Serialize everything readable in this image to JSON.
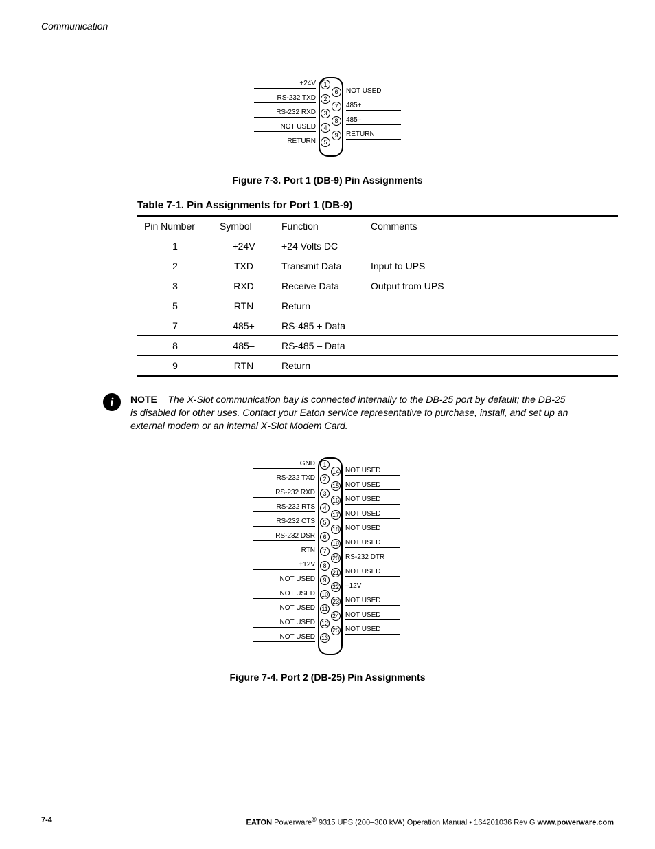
{
  "header": {
    "section": "Communication"
  },
  "figure73": {
    "caption": "Figure 7-3. Port 1 (DB-9) Pin Assignments",
    "left": [
      "+24V",
      "RS-232 TXD",
      "RS-232 RXD",
      "NOT USED",
      "RETURN"
    ],
    "right": [
      "NOT USED",
      "485+",
      "485–",
      "RETURN"
    ]
  },
  "table71": {
    "title": "Table 7-1. Pin Assignments for Port 1 (DB-9)",
    "headers": [
      "Pin Number",
      "Symbol",
      "Function",
      "Comments"
    ],
    "rows": [
      [
        "1",
        "+24V",
        "+24 Volts DC",
        ""
      ],
      [
        "2",
        "TXD",
        "Transmit Data",
        "Input to UPS"
      ],
      [
        "3",
        "RXD",
        "Receive Data",
        "Output from UPS"
      ],
      [
        "5",
        "RTN",
        "Return",
        ""
      ],
      [
        "7",
        "485+",
        "RS-485 + Data",
        ""
      ],
      [
        "8",
        "485–",
        "RS-485 – Data",
        ""
      ],
      [
        "9",
        "RTN",
        "Return",
        ""
      ]
    ]
  },
  "note": {
    "lead": "NOTE",
    "body": "The X-Slot communication bay is connected internally to the DB-25 port by default; the DB-25 is disabled for other uses. Contact your Eaton service representative to purchase, install, and set up an external modem or an internal X-Slot Modem Card."
  },
  "figure74": {
    "caption": "Figure 7-4. Port 2 (DB-25) Pin Assignments",
    "left": [
      "GND",
      "RS-232 TXD",
      "RS-232 RXD",
      "RS-232 RTS",
      "RS-232 CTS",
      "RS-232 DSR",
      "RTN",
      "+12V",
      "NOT USED",
      "NOT USED",
      "NOT USED",
      "NOT USED",
      "NOT USED"
    ],
    "right": [
      "NOT USED",
      "NOT USED",
      "NOT USED",
      "NOT USED",
      "NOT USED",
      "NOT USED",
      "RS-232 DTR",
      "NOT USED",
      "–12V",
      "NOT USED",
      "NOT USED",
      "NOT USED"
    ]
  },
  "footer": {
    "page": "7-4",
    "brand": "EATON",
    "product": "Powerware",
    "reg": "®",
    "tail": " 9315 UPS (200–300 kVA) Operation Manual  •  164201036 Rev G  ",
    "url": "www.powerware.com"
  }
}
